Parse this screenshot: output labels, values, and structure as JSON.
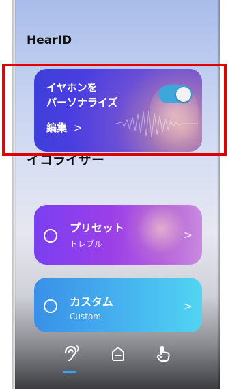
{
  "sections": {
    "hearid_title": "HearID",
    "equalizer_title": "イコライザー"
  },
  "hearid_card": {
    "line1": "イヤホンを",
    "line2": "パーソナライズ",
    "edit_label": "編集",
    "chevron": ">",
    "toggle_on": true,
    "toggle_color": "#3fa6dc"
  },
  "equalizer": {
    "items": [
      {
        "label": "プリセット",
        "sub": "トレブル",
        "selected": false,
        "chevron": ">"
      },
      {
        "label": "カスタム",
        "sub": "Custom",
        "selected": false,
        "chevron": ">"
      }
    ]
  },
  "nav": {
    "items": [
      "hearing-icon",
      "home-icon",
      "touch-icon"
    ],
    "active": "hearing-icon",
    "accent": "#2aa8f2"
  },
  "highlight_color": "#e00000"
}
